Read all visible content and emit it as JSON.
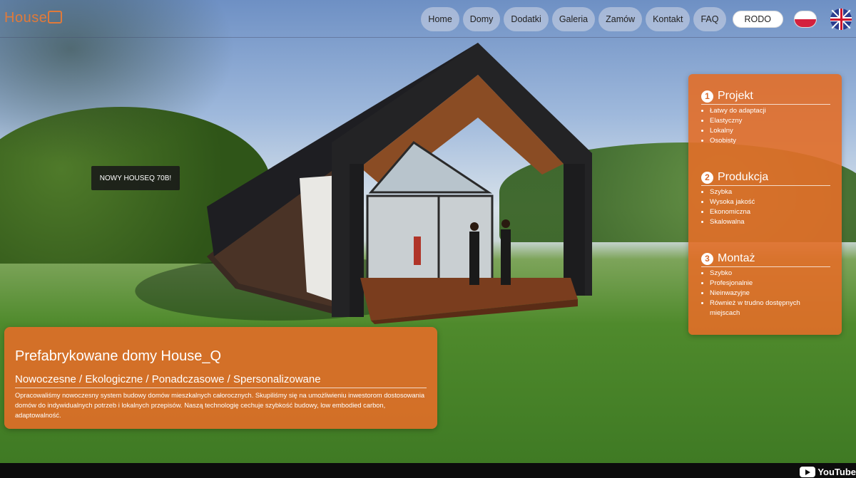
{
  "logo": {
    "text": "House",
    "mark": "Q"
  },
  "nav": {
    "items": [
      "Home",
      "Domy",
      "Dodatki",
      "Galeria",
      "Zamów",
      "Kontakt",
      "FAQ"
    ],
    "rodo": "RODO",
    "flags": [
      "polish-flag-icon",
      "uk-flag-icon"
    ]
  },
  "badge": "NOWY HOUSEQ 70B!",
  "steps": [
    {
      "num": "1",
      "title": "Projekt",
      "items": [
        "Łatwy do adaptacji",
        "Elastyczny",
        "Lokalny",
        "Osobisty"
      ]
    },
    {
      "num": "2",
      "title": "Produkcja",
      "items": [
        "Szybka",
        "Wysoka jakość",
        "Ekonomiczna",
        "Skalowalna"
      ]
    },
    {
      "num": "3",
      "title": "Montaż",
      "items": [
        "Szybko",
        "Profesjonalnie",
        "Nieinwazyjne",
        "Również w trudno dostępnych miejscach"
      ]
    }
  ],
  "hero": {
    "title": "Prefabrykowane domy House_Q",
    "subtitle": "Nowoczesne / Ekologiczne / Ponadczasowe / Spersonalizowane",
    "text": "Opracowaliśmy nowoczesny system budowy domów mieszkalnych całorocznych. Skupiliśmy się na umożliwieniu inwestorom dostosowania domów do indywidualnych potrzeb i lokalnych przepisów. Naszą technologię cechuje szybkość budowy, low embodied carbon, adaptowalność."
  },
  "video": {
    "brand": "YouTube"
  },
  "colors": {
    "accent": "#e26e28",
    "nav_pill": "#d2d7e6",
    "bottom_bar": "#0c0c0c"
  }
}
